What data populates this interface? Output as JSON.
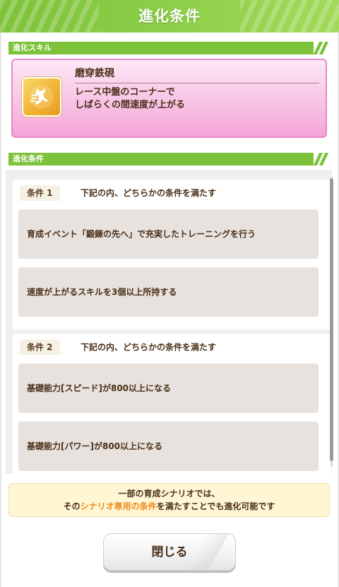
{
  "header": {
    "title": "進化条件"
  },
  "skill_section": {
    "label": "進化スキル",
    "skill": {
      "icon": "running-figure-icon",
      "name": "磨穿鉄硯",
      "description_line1": "レース中盤のコーナーで",
      "description_line2": "しばらくの間速度が上がる"
    }
  },
  "conditions_section": {
    "label": "進化条件",
    "groups": [
      {
        "badge": "条件 1",
        "text": "下記の内、どちらかの条件を満たす",
        "items": [
          "育成イベント「鍛錬の先へ」で充実したトレーニングを行う",
          "速度が上がるスキルを3個以上所持する"
        ]
      },
      {
        "badge": "条件 2",
        "text": "下記の内、どちらかの条件を満たす",
        "items": [
          "基礎能力[スピード]が800以上になる",
          "基礎能力[パワー]が800以上になる"
        ]
      }
    ]
  },
  "notice": {
    "line1": "一部の育成シナリオでは、",
    "line2_prefix": "その",
    "line2_highlight": "シナリオ専用の条件",
    "line2_suffix": "を満たすことでも進化可能です"
  },
  "close_button": {
    "label": "閉じる"
  },
  "colors": {
    "header_green": "#8fd04a",
    "section_green": "#7cc23a",
    "skill_pink": "#f7bde2",
    "text_brown": "#4a2f18",
    "highlight_orange": "#ef8a1c"
  }
}
